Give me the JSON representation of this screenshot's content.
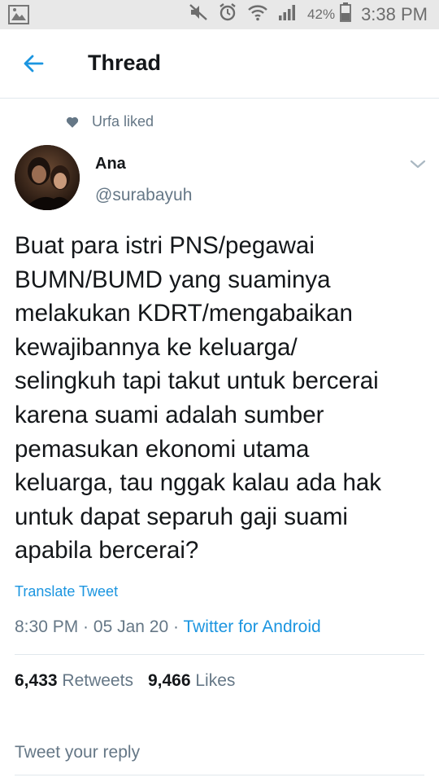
{
  "status_bar": {
    "battery_pct": "42%",
    "time": "3:38 PM",
    "icons": [
      "gallery-icon",
      "mute-icon",
      "alarm-icon",
      "wifi-icon",
      "signal-icon",
      "battery-icon"
    ]
  },
  "header": {
    "title": "Thread",
    "back_icon": "arrow-left-icon"
  },
  "social_context": {
    "text": "Urfa liked",
    "icon": "heart-icon"
  },
  "tweet": {
    "name": "Ana",
    "handle": "@surabayuh",
    "text_lines": [
      "Buat para istri PNS/pegawai",
      "BUMN/BUMD yang suaminya",
      "melakukan KDRT/mengabaikan",
      "kewajibannya ke keluarga/",
      "selingkuh tapi takut untuk bercerai",
      "karena suami adalah sumber",
      "pemasukan ekonomi utama",
      "keluarga, tau nggak kalau ada hak",
      "untuk dapat separuh gaji suami",
      "apabila bercerai?"
    ],
    "translate_label": "Translate Tweet",
    "time": "8:30 PM",
    "sep1": " · ",
    "date": "05 Jan 20",
    "sep2": " · ",
    "source": "Twitter for Android",
    "retweets_count": "6,433",
    "retweets_label": "Retweets",
    "likes_count": "9,466",
    "likes_label": "Likes"
  },
  "reply": {
    "placeholder": "Tweet your reply"
  },
  "colors": {
    "accent": "#1b95e0",
    "muted": "#657786",
    "text": "#14171a",
    "divider": "#e1e8ed",
    "status_bar": "#e8e8e8"
  }
}
